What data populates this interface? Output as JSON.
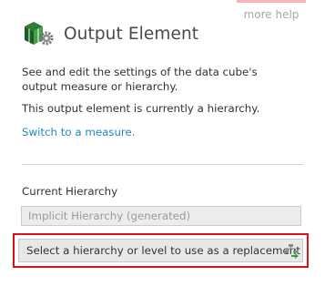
{
  "help": {
    "label": "more help"
  },
  "header": {
    "title": "Output Element",
    "icon": "data-cube-gear-icon"
  },
  "body": {
    "description": "See and edit the settings of the data cube's output measure or hierarchy.",
    "status": "This output element is currently a hierarchy.",
    "switch_link": "Switch to a measure."
  },
  "current_hierarchy": {
    "label": "Current Hierarchy",
    "value": "Implicit Hierarchy (generated)"
  },
  "replacement": {
    "label": "Select a hierarchy or level to use as a replacement",
    "icon": "hierarchy-select-icon"
  },
  "colors": {
    "accent": "#1e88c8",
    "highlight": "#d9121e",
    "cube_green": "#2e7d32",
    "help_border": "#f4b6ba"
  }
}
